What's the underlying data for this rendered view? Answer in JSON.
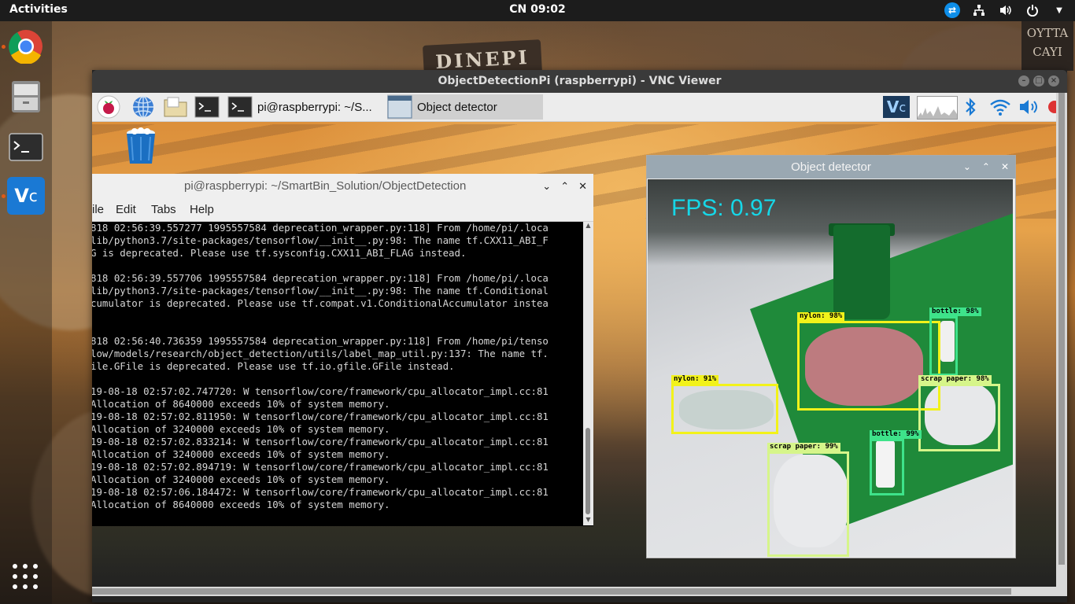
{
  "topbar": {
    "activities": "Activities",
    "clock": "CN 09:02",
    "tray": [
      "teamviewer-icon",
      "network-icon",
      "volume-icon",
      "power-icon",
      "menu-arrow-icon"
    ]
  },
  "dock": {
    "items": [
      "chrome-icon",
      "files-icon",
      "terminal-icon",
      "vnc-viewer-icon"
    ],
    "apps_button": "show-applications-icon"
  },
  "vnc": {
    "title": "ObjectDetectionPi (raspberrypi) - VNC Viewer"
  },
  "pi_panel": {
    "terminal_task": "pi@raspberrypi: ~/S...",
    "detector_task": "Object detector"
  },
  "terminal": {
    "title": "pi@raspberrypi: ~/SmartBin_Solution/ObjectDetection",
    "menu": [
      "ile",
      "Edit",
      "Tabs",
      "Help"
    ],
    "lines": [
      "818 02:56:39.557277 1995557584 deprecation_wrapper.py:118] From /home/pi/.loca",
      "lib/python3.7/site-packages/tensorflow/__init__.py:98: The name tf.CXX11_ABI_F",
      "G is deprecated. Please use tf.sysconfig.CXX11_ABI_FLAG instead.",
      "",
      "818 02:56:39.557706 1995557584 deprecation_wrapper.py:118] From /home/pi/.loca",
      "lib/python3.7/site-packages/tensorflow/__init__.py:98: The name tf.Conditional",
      "cumulator is deprecated. Please use tf.compat.v1.ConditionalAccumulator instea",
      "",
      "",
      "818 02:56:40.736359 1995557584 deprecation_wrapper.py:118] From /home/pi/tenso",
      "low/models/research/object_detection/utils/label_map_util.py:137: The name tf.",
      "ile.GFile is deprecated. Please use tf.io.gfile.GFile instead.",
      "",
      "19-08-18 02:57:02.747720: W tensorflow/core/framework/cpu_allocator_impl.cc:81",
      "Allocation of 8640000 exceeds 10% of system memory.",
      "19-08-18 02:57:02.811950: W tensorflow/core/framework/cpu_allocator_impl.cc:81",
      "Allocation of 3240000 exceeds 10% of system memory.",
      "19-08-18 02:57:02.833214: W tensorflow/core/framework/cpu_allocator_impl.cc:81",
      "Allocation of 3240000 exceeds 10% of system memory.",
      "19-08-18 02:57:02.894719: W tensorflow/core/framework/cpu_allocator_impl.cc:81",
      "Allocation of 3240000 exceeds 10% of system memory.",
      "19-08-18 02:57:06.184472: W tensorflow/core/framework/cpu_allocator_impl.cc:81",
      "Allocation of 8640000 exceeds 10% of system memory."
    ]
  },
  "detector": {
    "title": "Object detector",
    "fps": "FPS: 0.97",
    "detections": [
      {
        "label": "nylon: 98%",
        "color": "#f2f21a"
      },
      {
        "label": "bottle: 98%",
        "color": "#3ee38a"
      },
      {
        "label": "nylon: 91%",
        "color": "#f2f21a"
      },
      {
        "label": "scrap paper: 98%",
        "color": "#d6f58a"
      },
      {
        "label": "bottle: 99%",
        "color": "#3ee38a"
      },
      {
        "label": "scrap paper: 99%",
        "color": "#d6f58a"
      }
    ]
  },
  "colors": {
    "terminal_bg": "#000000",
    "fps_color": "#16d7e8",
    "topbar_bg": "#1c1c1c"
  }
}
